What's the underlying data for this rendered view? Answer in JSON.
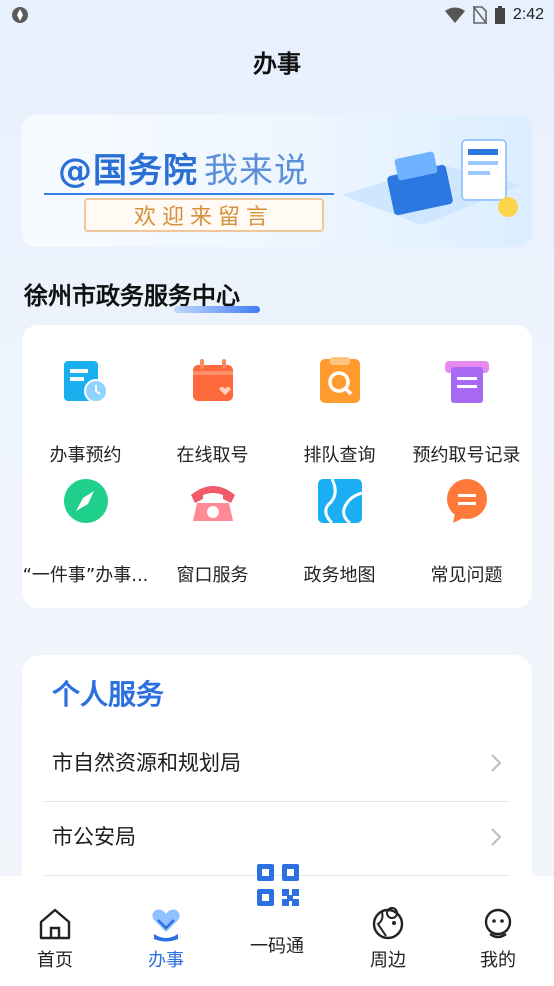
{
  "status_bar": {
    "time": "2:42"
  },
  "header": {
    "title": "办事"
  },
  "banner": {
    "title": "@国务院",
    "subtitle": "我来说",
    "pill_text": "欢迎来留言"
  },
  "center": {
    "name": "徐州市政务服务中心"
  },
  "services_grid": {
    "items": [
      {
        "label": "办事预约",
        "icon": "appointment-icon"
      },
      {
        "label": "在线取号",
        "icon": "calendar-ticket-icon"
      },
      {
        "label": "排队查询",
        "icon": "queue-search-icon"
      },
      {
        "label": "预约取号记录",
        "icon": "ticket-record-icon"
      },
      {
        "label": "“一件事”办事...",
        "icon": "compass-icon"
      },
      {
        "label": "窗口服务",
        "icon": "telephone-icon"
      },
      {
        "label": "政务地图",
        "icon": "map-icon"
      },
      {
        "label": "常见问题",
        "icon": "chat-bubble-icon"
      }
    ]
  },
  "personal_services": {
    "title": "个人服务",
    "rows": [
      {
        "label": "市自然资源和规划局"
      },
      {
        "label": "市公安局"
      }
    ]
  },
  "tab_bar": {
    "tabs": [
      {
        "label": "首页",
        "icon": "home-icon"
      },
      {
        "label": "办事",
        "icon": "heart-hands-icon",
        "active": true
      },
      {
        "label": "一码通",
        "icon": "qr-code-icon"
      },
      {
        "label": "周边",
        "icon": "location-globe-icon"
      },
      {
        "label": "我的",
        "icon": "smiley-user-icon"
      }
    ]
  },
  "colors": {
    "accent": "#2b6fe0",
    "text": "#1d1d1f",
    "background": "#eef4fd"
  }
}
